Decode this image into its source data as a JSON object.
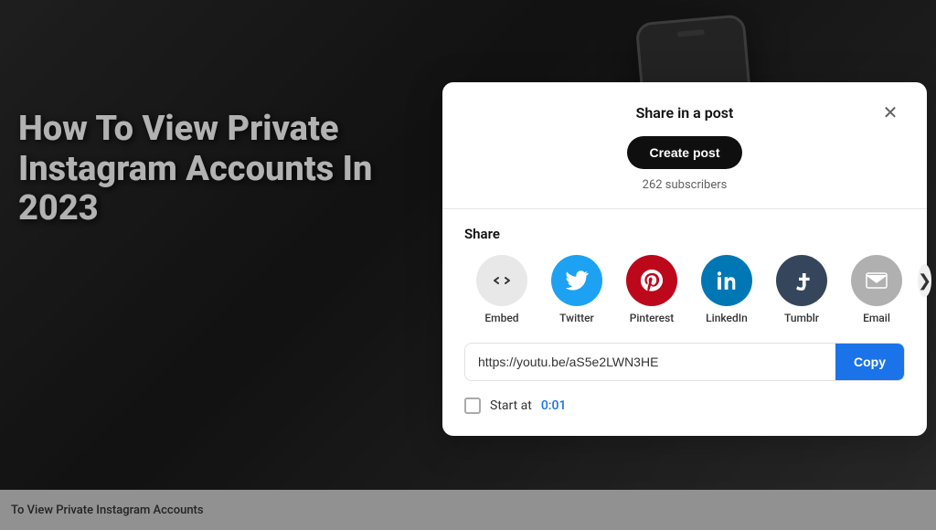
{
  "background": {
    "video_title": "How To View Private Instagram Accounts In 2023",
    "bottom_bar_text": "To View Private Instagram Accounts"
  },
  "modal": {
    "title": "Share in a post",
    "close_icon": "✕",
    "create_post_label": "Create post",
    "subscribers_text": "262 subscribers",
    "share_label": "Share",
    "share_items": [
      {
        "id": "embed",
        "label": "Embed",
        "color": "#e8e8e8",
        "icon_type": "embed"
      },
      {
        "id": "twitter",
        "label": "Twitter",
        "color": "#1da1f2",
        "icon_type": "twitter"
      },
      {
        "id": "pinterest",
        "label": "Pinterest",
        "color": "#bd081c",
        "icon_type": "pinterest"
      },
      {
        "id": "linkedin",
        "label": "LinkedIn",
        "color": "#0077b5",
        "icon_type": "linkedin"
      },
      {
        "id": "tumblr",
        "label": "Tumblr",
        "color": "#35465c",
        "icon_type": "tumblr"
      },
      {
        "id": "email",
        "label": "Email",
        "color": "#b0b0b0",
        "icon_type": "email"
      }
    ],
    "more_icon": "❯",
    "url_value": "https://youtu.be/aS5e2LWN3HE",
    "url_placeholder": "https://youtu.be/aS5e2LWN3HE",
    "copy_label": "Copy",
    "start_at_label": "Start at",
    "start_at_time": "0:01"
  }
}
